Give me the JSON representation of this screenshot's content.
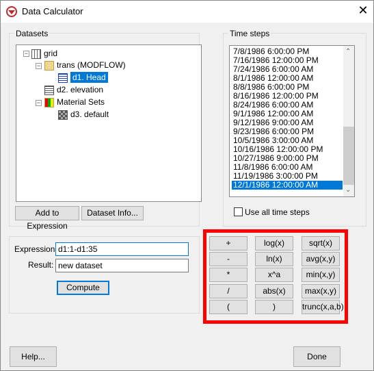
{
  "window": {
    "title": "Data Calculator",
    "close_icon": "close-icon",
    "app_icon": "calculator-logo-icon"
  },
  "datasets": {
    "label": "Datasets",
    "tree": [
      {
        "label": "grid",
        "icon": "grid-icon"
      },
      {
        "label": "trans (MODFLOW)",
        "icon": "locked-folder-icon"
      },
      {
        "label": "d1. Head",
        "icon": "dataset-icon",
        "selected": true
      },
      {
        "label": "d2. elevation",
        "icon": "dataset-icon"
      },
      {
        "label": "Material Sets",
        "icon": "material-folder-icon"
      },
      {
        "label": "d3. default",
        "icon": "material-dataset-icon"
      }
    ],
    "add_button": "Add to Expression",
    "info_button": "Dataset Info..."
  },
  "timesteps": {
    "label": "Time steps",
    "items": [
      "7/8/1986 6:00:00 PM",
      "7/16/1986 12:00:00 PM",
      "7/24/1986 6:00:00 AM",
      "8/1/1986 12:00:00 AM",
      "8/8/1986 6:00:00 PM",
      "8/16/1986 12:00:00 PM",
      "8/24/1986 6:00:00 AM",
      "9/1/1986 12:00:00 AM",
      "9/12/1986 9:00:00 AM",
      "9/23/1986 6:00:00 PM",
      "10/5/1986 3:00:00 AM",
      "10/16/1986 12:00:00 PM",
      "10/27/1986 9:00:00 PM",
      "11/8/1986 6:00:00 AM",
      "11/19/1986 3:00:00 PM",
      "12/1/1986 12:00:00 AM"
    ],
    "selected": "12/1/1986 12:00:00 AM",
    "use_all_label": "Use all time steps",
    "use_all_checked": false
  },
  "expression": {
    "label": "Expression:",
    "value": "d1:1-d1:35",
    "result_label": "Result:",
    "result_value": "new dataset",
    "compute": "Compute"
  },
  "calculator": {
    "buttons": [
      "+",
      "log(x)",
      "sqrt(x)",
      "-",
      "ln(x)",
      "avg(x,y)",
      "*",
      "x^a",
      "min(x,y)",
      "/",
      "abs(x)",
      "max(x,y)",
      "(",
      ")",
      "trunc(x,a,b)"
    ],
    "highlight_color": "#ff0000"
  },
  "footer": {
    "help": "Help...",
    "done": "Done"
  }
}
